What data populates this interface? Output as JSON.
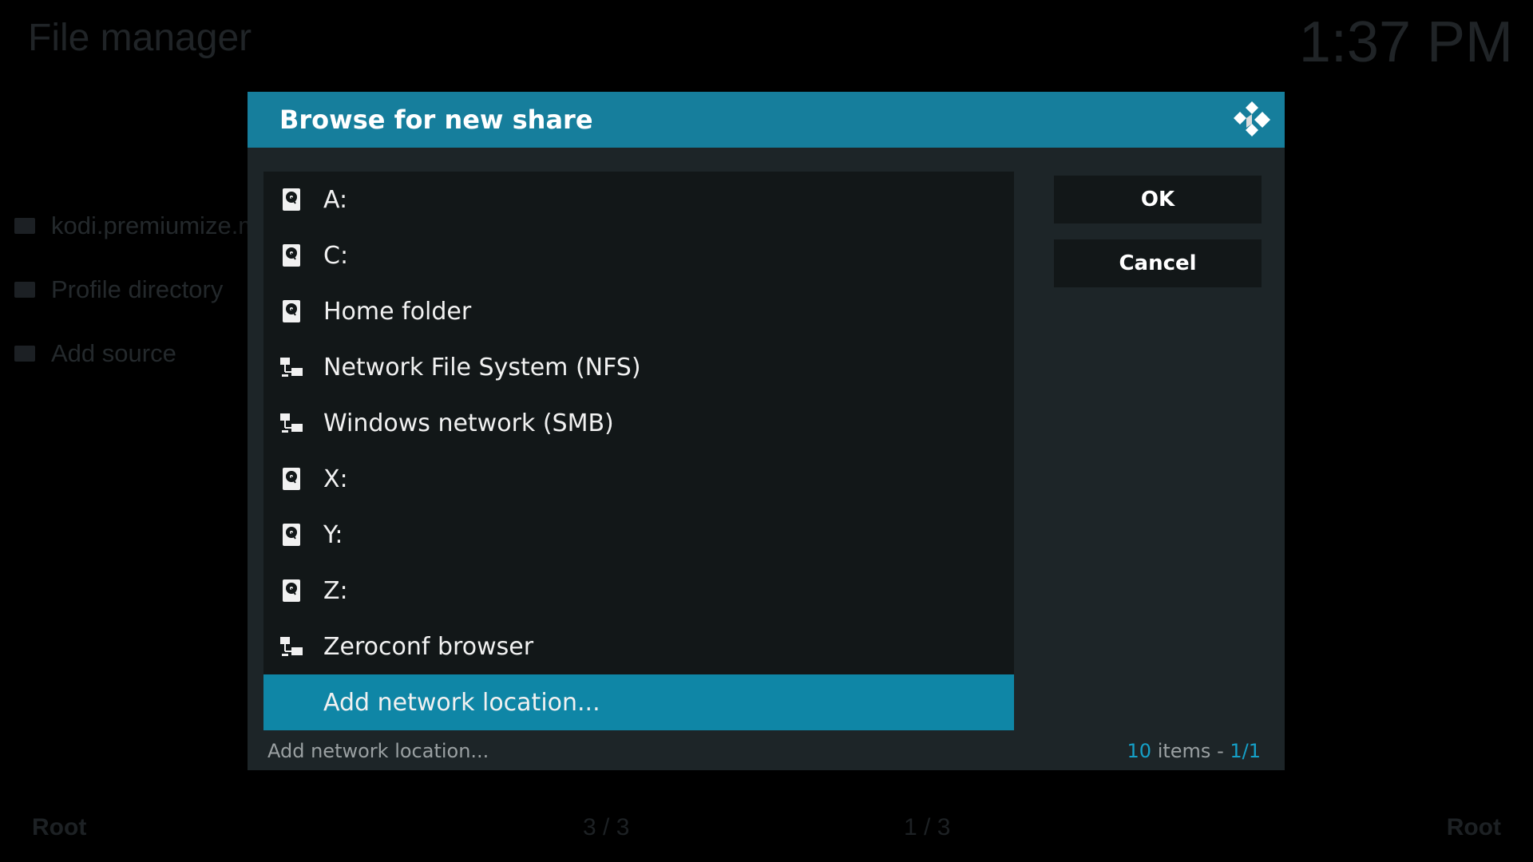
{
  "background": {
    "title": "File manager",
    "clock": "1:37 PM",
    "side_items": [
      {
        "label": "kodi.premiumize.m"
      },
      {
        "label": "Profile directory"
      },
      {
        "label": "Add source"
      }
    ],
    "footer": {
      "left_label": "Root",
      "center_left": "3 / 3",
      "center_right": "1 / 3",
      "right_label": "Root"
    }
  },
  "dialog": {
    "title": "Browse for new share",
    "items": [
      {
        "label": "A:",
        "icon": "hard-drive-icon"
      },
      {
        "label": "C:",
        "icon": "hard-drive-icon"
      },
      {
        "label": "Home folder",
        "icon": "hard-drive-icon"
      },
      {
        "label": "Network File System (NFS)",
        "icon": "network-icon"
      },
      {
        "label": "Windows network (SMB)",
        "icon": "network-icon"
      },
      {
        "label": "X:",
        "icon": "hard-drive-icon"
      },
      {
        "label": "Y:",
        "icon": "hard-drive-icon"
      },
      {
        "label": "Z:",
        "icon": "hard-drive-icon"
      },
      {
        "label": "Zeroconf browser",
        "icon": "network-icon"
      },
      {
        "label": "Add network location...",
        "icon": "",
        "selected": true
      }
    ],
    "buttons": {
      "ok": "OK",
      "cancel": "Cancel"
    },
    "status": {
      "selected_label": "Add network location...",
      "item_count": "10",
      "items_word": "items",
      "separator": "-",
      "page": "1/1"
    },
    "colors": {
      "header": "#167e9c",
      "selected": "#0f86a6",
      "accent": "#15a0c8"
    }
  }
}
